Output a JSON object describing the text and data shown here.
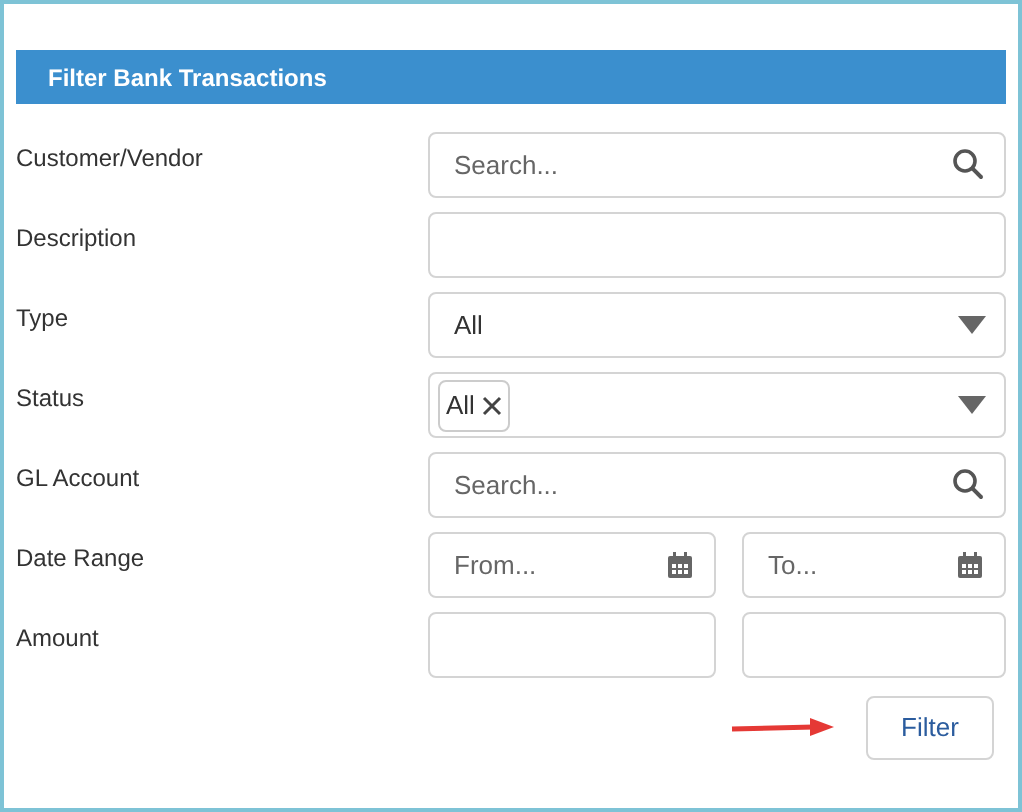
{
  "panel": {
    "title": "Filter Bank Transactions"
  },
  "fields": [
    {
      "kind": "search",
      "label": "Customer/Vendor",
      "placeholder": "Search..."
    },
    {
      "kind": "text",
      "label": "Description"
    },
    {
      "kind": "select",
      "label": "Type",
      "value": "All"
    },
    {
      "kind": "tags",
      "label": "Status",
      "tags": [
        "All"
      ]
    },
    {
      "kind": "search",
      "label": "GL Account",
      "placeholder": "Search..."
    },
    {
      "kind": "daterange",
      "label": "Date Range",
      "placeholders": [
        "From...",
        "To..."
      ]
    },
    {
      "kind": "pair",
      "label": "Amount"
    }
  ],
  "button": {
    "label": "Filter"
  }
}
